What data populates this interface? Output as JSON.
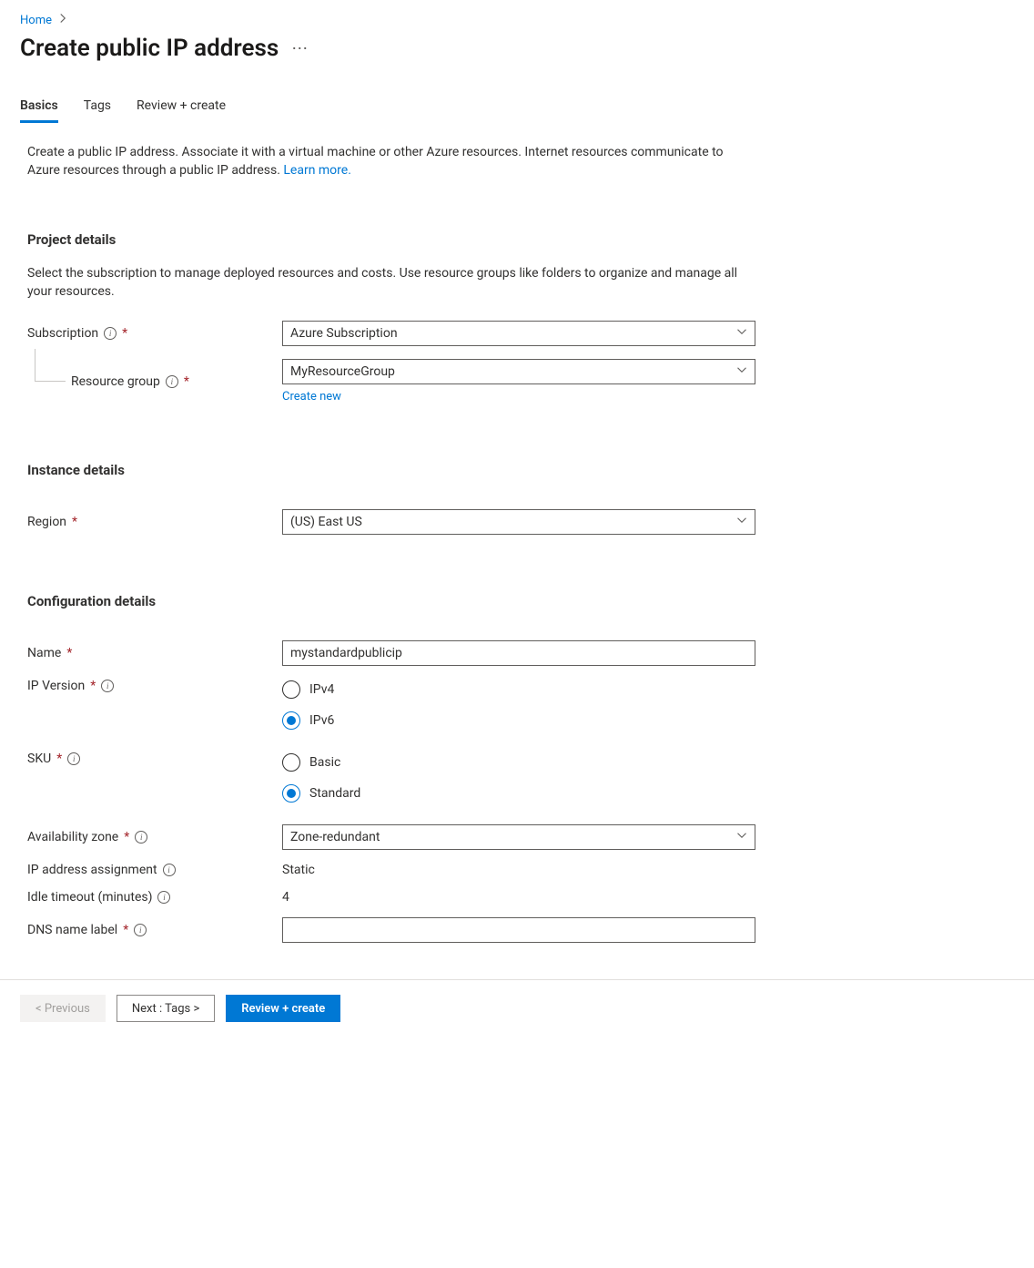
{
  "breadcrumb": {
    "home": "Home"
  },
  "page": {
    "title": "Create public IP address"
  },
  "tabs": {
    "basics": "Basics",
    "tags": "Tags",
    "review": "Review + create"
  },
  "intro": {
    "text": "Create a public IP address. Associate it with a virtual machine or other Azure resources. Internet resources communicate to Azure resources through a public IP address. ",
    "link": "Learn more."
  },
  "project": {
    "heading": "Project details",
    "desc": "Select the subscription to manage deployed resources and costs. Use resource groups like folders to organize and manage all your resources.",
    "subscription_label": "Subscription",
    "subscription_value": "Azure Subscription",
    "rg_label": "Resource group",
    "rg_value": "MyResourceGroup",
    "create_new": "Create new"
  },
  "instance": {
    "heading": "Instance details",
    "region_label": "Region",
    "region_value": "(US) East US"
  },
  "config": {
    "heading": "Configuration details",
    "name_label": "Name",
    "name_value": "mystandardpublicip",
    "ipver_label": "IP Version",
    "ipver_opt1": "IPv4",
    "ipver_opt2": "IPv6",
    "sku_label": "SKU",
    "sku_opt1": "Basic",
    "sku_opt2": "Standard",
    "az_label": "Availability zone",
    "az_value": "Zone-redundant",
    "ipassign_label": "IP address assignment",
    "ipassign_value": "Static",
    "idle_label": "Idle timeout (minutes)",
    "idle_value": "4",
    "dns_label": "DNS name label",
    "dns_value": ""
  },
  "footer": {
    "prev": "< Previous",
    "next": "Next : Tags >",
    "review": "Review + create"
  }
}
